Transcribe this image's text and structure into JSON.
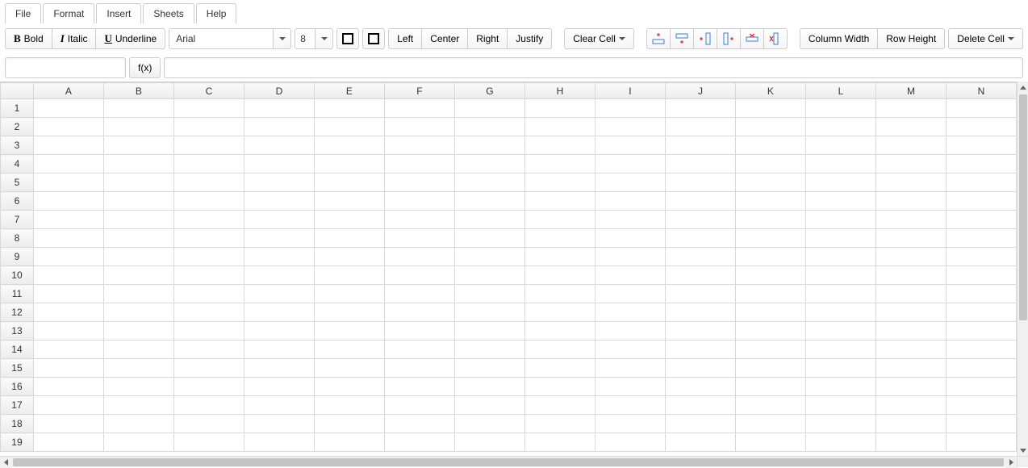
{
  "menubar": {
    "items": [
      "File",
      "Format",
      "Insert",
      "Sheets",
      "Help"
    ]
  },
  "toolbar": {
    "bold_label": "Bold",
    "italic_label": "Italic",
    "underline_label": "Underline",
    "font_name": "Arial",
    "font_size": "8",
    "align_left": "Left",
    "align_center": "Center",
    "align_right": "Right",
    "align_justify": "Justify",
    "clear_cell": "Clear Cell",
    "column_width": "Column Width",
    "row_height": "Row Height",
    "delete_cell": "Delete Cell"
  },
  "formula_bar": {
    "cell_ref": "",
    "fx_label": "f(x)",
    "formula": ""
  },
  "grid": {
    "columns": [
      "A",
      "B",
      "C",
      "D",
      "E",
      "F",
      "G",
      "H",
      "I",
      "J",
      "K",
      "L",
      "M",
      "N"
    ],
    "rows": [
      "1",
      "2",
      "3",
      "4",
      "5",
      "6",
      "7",
      "8",
      "9",
      "10",
      "11",
      "12",
      "13",
      "14",
      "15",
      "16",
      "17",
      "18",
      "19"
    ]
  }
}
